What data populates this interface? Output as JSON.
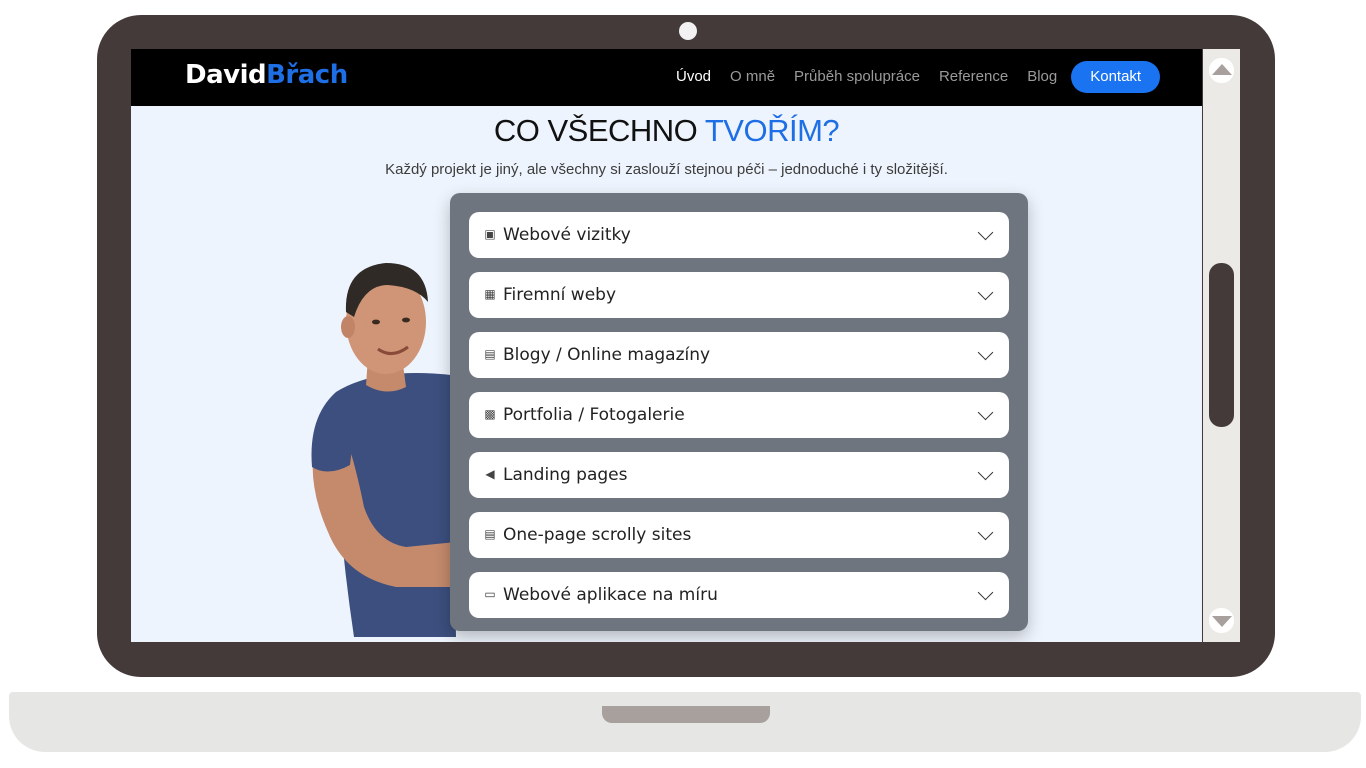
{
  "brand": {
    "first": "David",
    "second": "Břach",
    "accent_color": "#1e6fe6"
  },
  "nav": {
    "links": [
      "Úvod",
      "O mně",
      "Průběh spolupráce",
      "Reference",
      "Blog"
    ],
    "cta": "Kontakt",
    "cta_color": "#1a73f0"
  },
  "section": {
    "title_main": "CO VŠECHNO ",
    "title_accent": "TVOŘÍM?",
    "subtitle": "Každý projekt je jiný, ale všechny si zaslouží stejnou péči – jednoduché i ty složitější."
  },
  "accordion": [
    {
      "icon": "id-card-icon",
      "label": "Webové vizitky"
    },
    {
      "icon": "building-icon",
      "label": "Firemní weby"
    },
    {
      "icon": "newspaper-icon",
      "label": "Blogy / Online magazíny"
    },
    {
      "icon": "image-icon",
      "label": "Portfolia / Fotogalerie"
    },
    {
      "icon": "megaphone-icon",
      "label": "Landing pages"
    },
    {
      "icon": "scroll-icon",
      "label": "One-page scrolly sites"
    },
    {
      "icon": "laptop-icon",
      "label": "Webové aplikace na míru"
    }
  ],
  "colors": {
    "page_bg": "#eef4fd",
    "panel_bg": "#6f757e",
    "frame": "#453a3a"
  }
}
